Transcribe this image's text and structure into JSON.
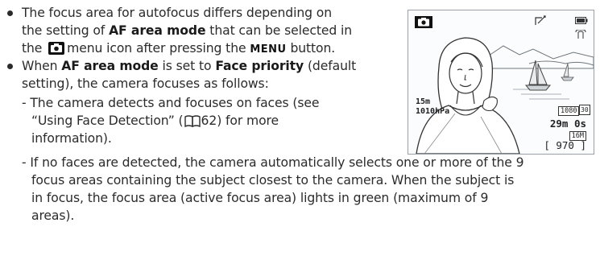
{
  "bullet1": {
    "line1": "The focus area for autofocus differs depending on",
    "line2_pre": "the setting of ",
    "line2_bold": "AF area mode",
    "line2_post": " that can be selected in",
    "line3_pre": "the",
    "line3_mid": "menu icon after pressing the",
    "menu_word": "MENU",
    "line3_post": " button."
  },
  "bullet2": {
    "line1_pre": "When ",
    "line1_bold1": "AF area mode",
    "line1_mid": " is set to ",
    "line1_bold2": "Face priority",
    "line1_post": " (default",
    "line2": "setting), the camera focuses as follows:"
  },
  "sub1": {
    "line1": "- The camera detects and focuses on faces (see",
    "line2_pre": "“Using Face Detection” (",
    "line2_page": "62",
    "line2_post": ") for more",
    "line3": "information)."
  },
  "sub2": {
    "line1": "- If no faces are detected, the camera automatically selects one or more of the 9",
    "line2": "focus areas containing the subject closest to the camera. When the subject is",
    "line3": "in focus, the focus area (active focus area) lights in green (maximum of 9",
    "line4": "areas)."
  },
  "screen": {
    "altitude": "15m",
    "pressure": "1010hPa",
    "video_size": "1080",
    "video_fps": "30",
    "rec_time": "29m 0s",
    "memory_tag": "16M",
    "exposures": "[ 970 ]"
  }
}
